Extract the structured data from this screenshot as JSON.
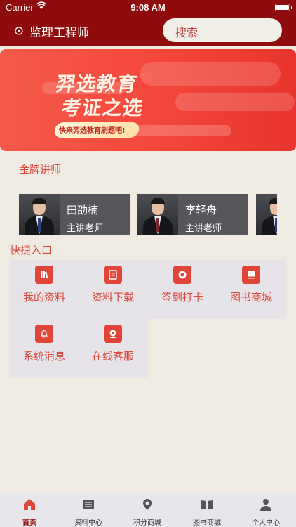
{
  "status_bar": {
    "carrier": "Carrier",
    "time": "9:08 AM"
  },
  "nav": {
    "title": "监理工程师",
    "search_placeholder": "搜索",
    "logo_icon": "logo-icon"
  },
  "banner": {
    "line1": "羿选教育",
    "line2": "考证之选",
    "tagline": "快来羿选教育刷题吧!"
  },
  "sections": {
    "teachers_title": "金牌讲师",
    "quick_title": "快捷入口"
  },
  "teachers": [
    {
      "name": "田劭楠",
      "role": "主讲老师"
    },
    {
      "name": "李轻舟",
      "role": "主讲老师"
    }
  ],
  "quick_entries": [
    {
      "label": "我的资料",
      "icon": "books-icon"
    },
    {
      "label": "资料下载",
      "icon": "document-icon"
    },
    {
      "label": "签到打卡",
      "icon": "coin-icon"
    },
    {
      "label": "图书商城",
      "icon": "book-icon"
    },
    {
      "label": "系统消息",
      "icon": "bell-icon"
    },
    {
      "label": "在线客服",
      "icon": "support-icon"
    }
  ],
  "tabs": [
    {
      "label": "首页",
      "icon": "home-icon"
    },
    {
      "label": "资料中心",
      "icon": "files-icon"
    },
    {
      "label": "积分商城",
      "icon": "points-icon"
    },
    {
      "label": "图书商城",
      "icon": "open-book-icon"
    },
    {
      "label": "个人中心",
      "icon": "person-icon"
    }
  ],
  "colors": {
    "header": "#8f0c0c",
    "accent": "#d9463a",
    "background": "#efebe3"
  }
}
